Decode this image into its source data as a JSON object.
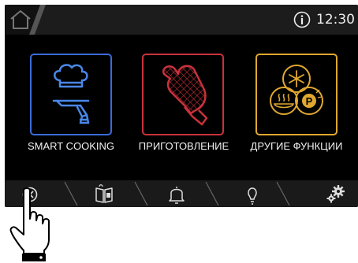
{
  "status": {
    "time": "12:30",
    "info_icon": "info-icon"
  },
  "menu": {
    "items": [
      {
        "label": "SMART COOKING",
        "icon": "chef-serving-icon",
        "color": "#3a6cd8"
      },
      {
        "label": "ПРИГОТОВЛЕНИЕ",
        "icon": "oven-mitt-icon",
        "color": "#c8323c"
      },
      {
        "label": "ДРУГИЕ ФУНКЦИИ",
        "icon": "other-functions-icon",
        "color": "#e0a830"
      }
    ]
  },
  "bottom_nav": {
    "items": [
      {
        "icon": "power-icon"
      },
      {
        "icon": "recipe-book-icon"
      },
      {
        "icon": "bell-icon"
      },
      {
        "icon": "light-bulb-icon"
      },
      {
        "icon": "settings-icon"
      }
    ]
  },
  "colors": {
    "screen_bg": "#000000",
    "bar_bg": "#1a1a1a",
    "text": "#f2f2f2"
  }
}
